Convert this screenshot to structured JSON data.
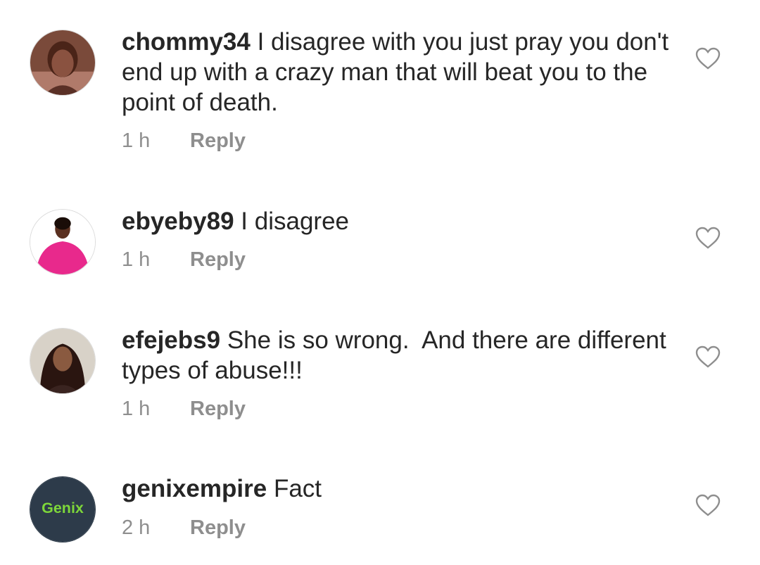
{
  "comments": [
    {
      "username": "chommy34",
      "text": "I disagree with you just pray you don't end up with a crazy man that will beat you to the point of death.",
      "time": "1 h",
      "reply_label": "Reply"
    },
    {
      "username": "ebyeby89",
      "text": "I disagree",
      "time": "1 h",
      "reply_label": "Reply"
    },
    {
      "username": "efejebs9",
      "text": "She is so wrong.  And there are different types of abuse!!!",
      "time": "1 h",
      "reply_label": "Reply"
    },
    {
      "username": "genixempire",
      "text": "Fact",
      "time": "2 h",
      "reply_label": "Reply",
      "avatar_logo_text": "Genix"
    }
  ],
  "icons": {
    "like": "heart-outline-icon"
  },
  "colors": {
    "text": "#262626",
    "secondary": "#8e8e8e",
    "background": "#ffffff"
  }
}
